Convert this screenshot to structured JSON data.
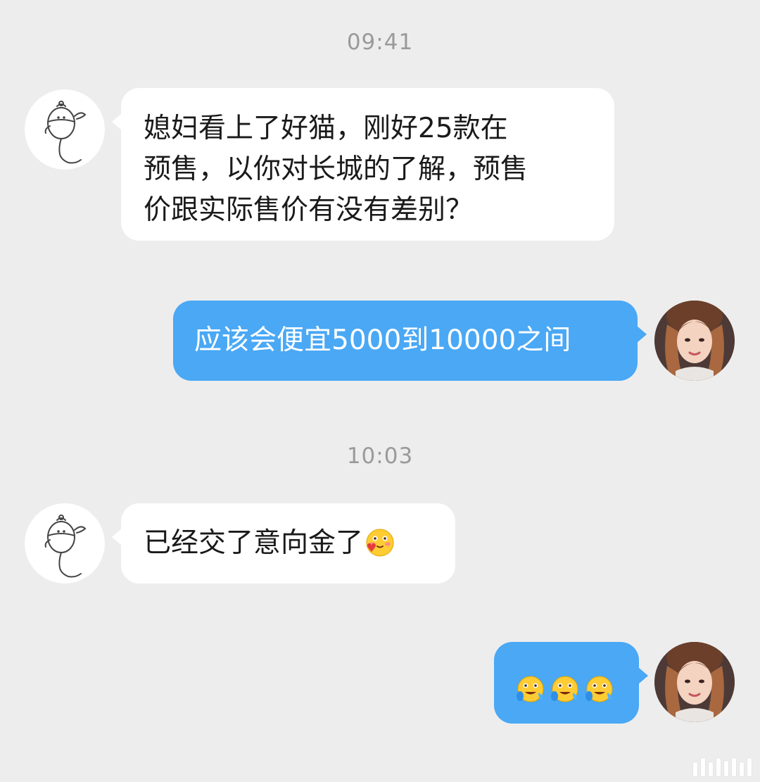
{
  "conversation": {
    "messages": [
      {
        "type": "timestamp",
        "text": "09:41"
      },
      {
        "type": "incoming",
        "text": "媳妇看上了好猫，刚好25款在\n预售，以你对长城的了解，预售\n价跟实际售价有没有差别？"
      },
      {
        "type": "outgoing",
        "text": "应该会便宜5000到10000之间"
      },
      {
        "type": "timestamp",
        "text": "10:03"
      },
      {
        "type": "incoming",
        "text": "已经交了意向金了",
        "emoji": "shy-love-emoji"
      },
      {
        "type": "outgoing",
        "emojis": [
          "crying-laugh-emoji",
          "crying-laugh-emoji",
          "crying-laugh-emoji"
        ]
      }
    ]
  },
  "avatars": {
    "contact": "sketch-pet-avatar",
    "me": "woman-photo-avatar"
  },
  "theme": {
    "background": "#ededed",
    "incoming_bubble": "#ffffff",
    "outgoing_bubble": "#4aa8f5",
    "timestamp_color": "#9a9a9a"
  }
}
